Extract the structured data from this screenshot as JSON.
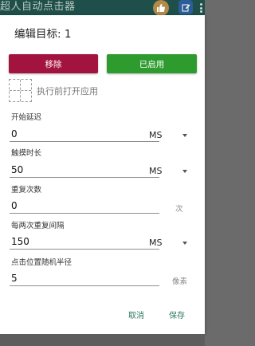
{
  "app": {
    "title": "超人自动点击器"
  },
  "topbar_icons": [
    "thumbs-up-icon",
    "edit-icon",
    "more-vertical-icon"
  ],
  "dialog": {
    "title": "编辑目标: 1",
    "remove_label": "移除",
    "enabled_label": "已启用",
    "pick_app_label": "执行前打开应用",
    "fields": {
      "start_delay": {
        "label": "开始延迟",
        "value": "0",
        "unit": "MS"
      },
      "touch_duration": {
        "label": "触摸时长",
        "value": "50",
        "unit": "MS"
      },
      "repeat_count": {
        "label": "重复次数",
        "value": "0",
        "unit": "次"
      },
      "repeat_interval": {
        "label": "每两次重复间隔",
        "value": "150",
        "unit": "MS"
      },
      "random_radius": {
        "label": "点击位置随机半径",
        "value": "5",
        "unit": "像素"
      }
    },
    "cancel_label": "取消",
    "save_label": "保存"
  },
  "colors": {
    "remove": "#a3133f",
    "enabled": "#2e9b2e",
    "accent_text": "#2b7a5d",
    "appbar": "#1e4f4a"
  }
}
